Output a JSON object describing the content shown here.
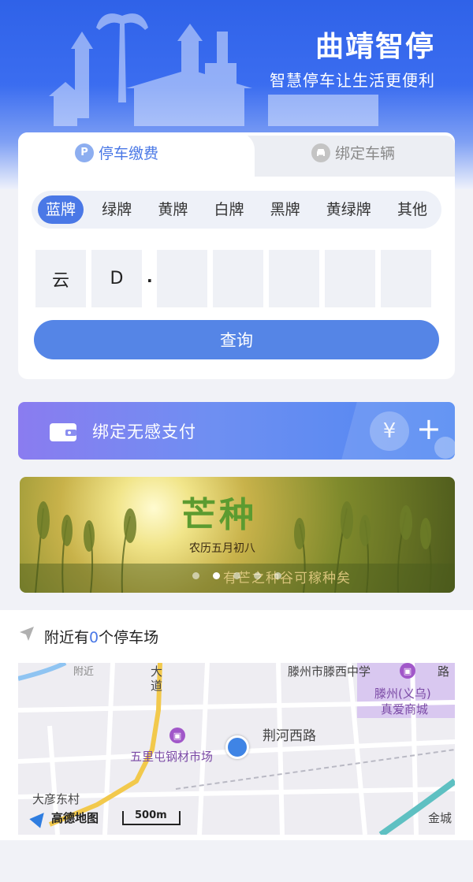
{
  "header": {
    "title": "曲靖智停",
    "subtitle": "智慧停车让生活更便利"
  },
  "tabs": [
    {
      "label": "停车缴费",
      "icon": "parking-icon",
      "icon_text": "P",
      "active": true
    },
    {
      "label": "绑定车辆",
      "icon": "car-icon",
      "icon_text": "🚘",
      "active": false
    }
  ],
  "plate_types": [
    "蓝牌",
    "绿牌",
    "黄牌",
    "白牌",
    "黑牌",
    "黄绿牌",
    "其他"
  ],
  "plate_selected": "蓝牌",
  "plate_chars": [
    "云",
    "D",
    "",
    "",
    "",
    "",
    ""
  ],
  "plate_separator": "·",
  "query_label": "查询",
  "bind_pay": {
    "label": "绑定无感支付",
    "yen": "¥",
    "plus": "+"
  },
  "banner": {
    "title": "芒种",
    "date": "农历五月初八",
    "poem": "有芒之种谷可稼种矣",
    "slide_count": 5,
    "active_slide": 1
  },
  "nearby": {
    "prefix": "附近有",
    "count": "0",
    "suffix": "个停车场"
  },
  "map": {
    "labels": {
      "school": "滕州市滕西中学",
      "road_top_right": "路",
      "avenue": "大\n道",
      "mall_line1": "滕州(义乌)",
      "mall_line2": "真爱商城",
      "street": "荆河西路",
      "market": "五里屯钢材市场",
      "village": "大彦东村",
      "jincheng": "金城",
      "road_top": "附近"
    },
    "logo": "高德地图",
    "scale": "500m"
  },
  "colors": {
    "accent": "#4a78e6",
    "header_blue": "#2f62e8",
    "poi_purple": "#a157c9"
  }
}
